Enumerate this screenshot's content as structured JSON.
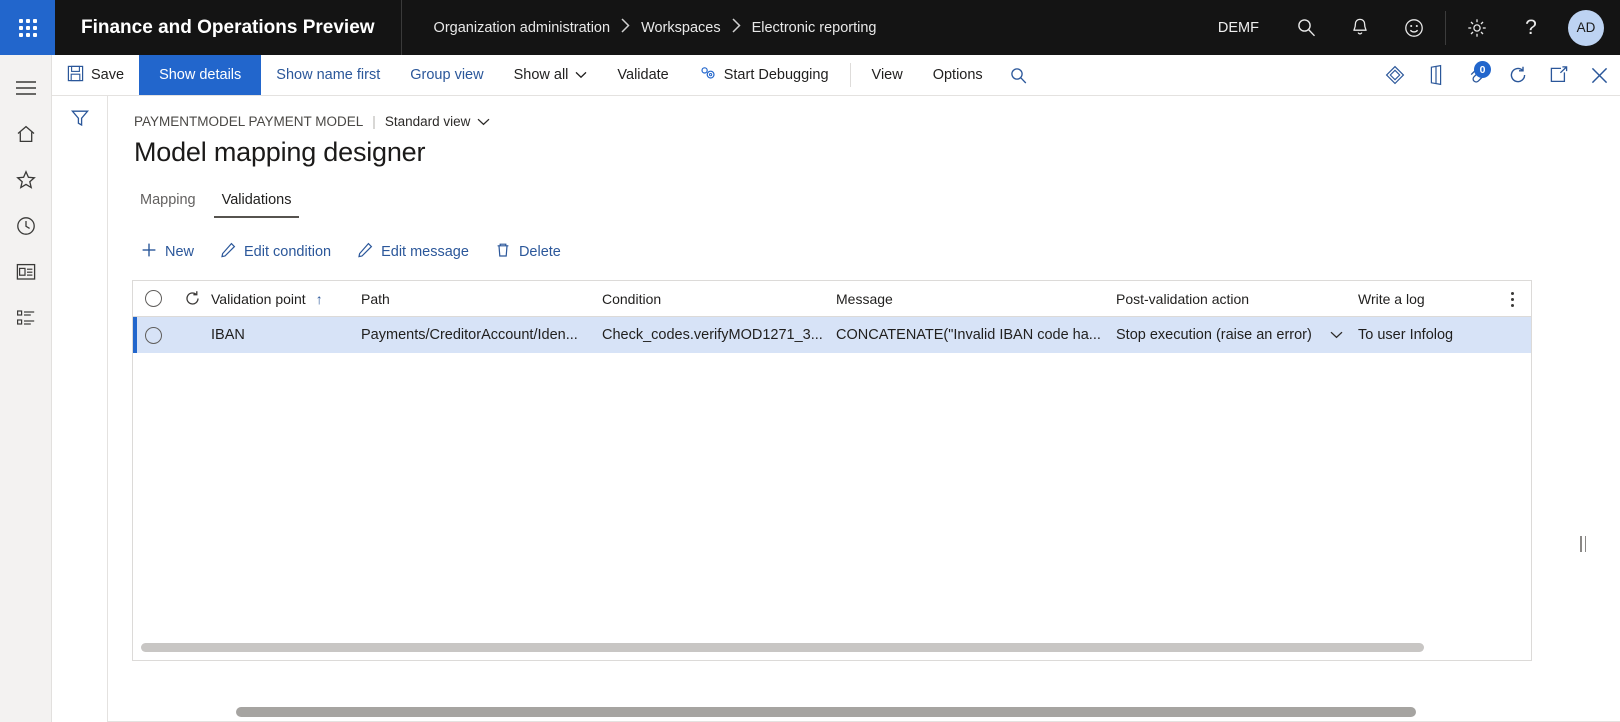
{
  "topbar": {
    "waffle_label": "app-launcher",
    "brand": "Finance and Operations Preview",
    "breadcrumbs": [
      {
        "label": "Organization administration"
      },
      {
        "label": "Workspaces"
      },
      {
        "label": "Electronic reporting"
      }
    ],
    "company": "DEMF",
    "icons": [
      "search-icon",
      "notifications-icon",
      "feedback-smiley-icon",
      "settings-gear-icon",
      "help-icon"
    ],
    "help_glyph": "?",
    "avatar_initials": "AD"
  },
  "rail": {
    "items": [
      {
        "name": "navigation-menu",
        "label": "Expand the navigation pane"
      },
      {
        "name": "home",
        "label": "Home"
      },
      {
        "name": "favorites",
        "label": "Favorites"
      },
      {
        "name": "recent",
        "label": "Recent"
      },
      {
        "name": "workspaces",
        "label": "Workspaces"
      },
      {
        "name": "modules",
        "label": "Modules"
      }
    ]
  },
  "commandbar": {
    "save": "Save",
    "show_details": "Show details",
    "show_name_first": "Show name first",
    "group_view": "Group view",
    "show_all": "Show all",
    "validate": "Validate",
    "start_debugging": "Start Debugging",
    "view": "View",
    "options": "Options",
    "search_icon": "search-icon",
    "right_icons": [
      {
        "name": "personalize-icon"
      },
      {
        "name": "office-apps-icon"
      },
      {
        "name": "attachments-icon",
        "badge": "0"
      },
      {
        "name": "refresh-icon"
      },
      {
        "name": "open-in-new-window-icon"
      },
      {
        "name": "close-icon"
      }
    ]
  },
  "filterpane": {
    "icon": "filter-funnel-icon"
  },
  "page": {
    "eyebrow": "PAYMENTMODEL PAYMENT MODEL",
    "eyebrow_separator": "|",
    "view_selector": "Standard view",
    "title": "Model mapping designer",
    "tabs": [
      {
        "label": "Mapping",
        "active": false
      },
      {
        "label": "Validations",
        "active": true
      }
    ],
    "actions": [
      {
        "label": "New",
        "icon": "plus-icon"
      },
      {
        "label": "Edit condition",
        "icon": "pencil-icon"
      },
      {
        "label": "Edit message",
        "icon": "pencil-icon"
      },
      {
        "label": "Delete",
        "icon": "trash-icon"
      }
    ]
  },
  "grid": {
    "columns": {
      "validation_point": "Validation point",
      "path": "Path",
      "condition": "Condition",
      "message": "Message",
      "post_validation_action": "Post-validation action",
      "write_a_log": "Write a log"
    },
    "sort_indicator": "↑",
    "refresh_icon": "refresh-column-icon",
    "overflow_icon": "more-options-kebab-icon",
    "rows": [
      {
        "validation_point": "IBAN",
        "path": "Payments/CreditorAccount/Iden...",
        "condition": "Check_codes.verifyMOD1271_3...",
        "message": "CONCATENATE(\"Invalid IBAN code ha...",
        "post_validation_action": "Stop execution (raise an error)",
        "write_a_log": "To user Infolog",
        "selected": true
      }
    ]
  },
  "colors": {
    "accent": "#2266cc",
    "link": "#2b579a",
    "topbar_bg": "#141414",
    "selected_row_bg": "#d7e3f7",
    "rail_bg": "#f3f2f1"
  }
}
